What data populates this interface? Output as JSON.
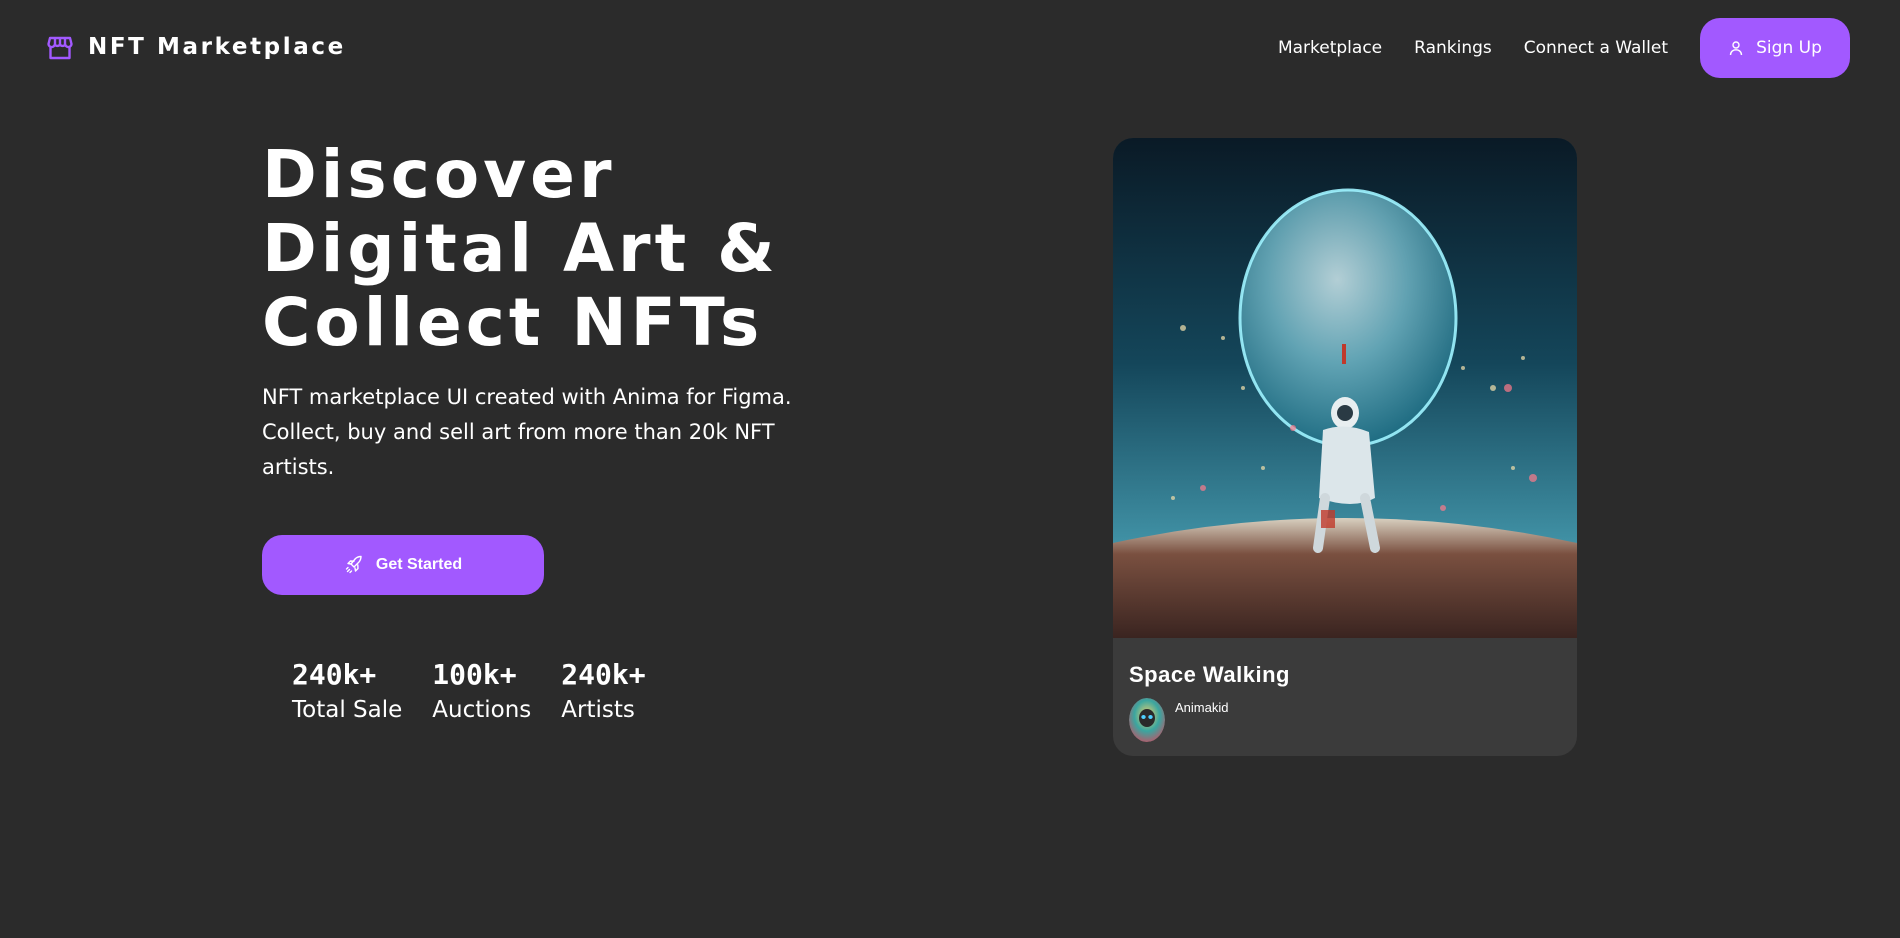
{
  "nav": {
    "brand": "NFT Marketplace",
    "brand_icon": "storefront-icon",
    "links": [
      "Marketplace",
      "Rankings",
      "Connect a Wallet"
    ],
    "signup_label": "Sign Up",
    "signup_icon": "user-icon"
  },
  "hero": {
    "title_lines": [
      "Discover",
      "Digital Art &",
      "Collect NFTs"
    ],
    "subtitle": "NFT marketplace UI created with Anima for Figma. Collect, buy and sell art from more than 20k NFT artists.",
    "cta_label": "Get Started",
    "cta_icon": "rocket-icon",
    "stats": [
      {
        "value": "240k+",
        "label": "Total Sale"
      },
      {
        "value": "100k+",
        "label": "Auctions"
      },
      {
        "value": "240k+",
        "label": "Artists"
      }
    ]
  },
  "featured": {
    "title": "Space Walking",
    "artist": "Animakid"
  },
  "colors": {
    "background": "#2b2b2b",
    "accent": "#a259ff",
    "card": "#3b3b3b"
  }
}
